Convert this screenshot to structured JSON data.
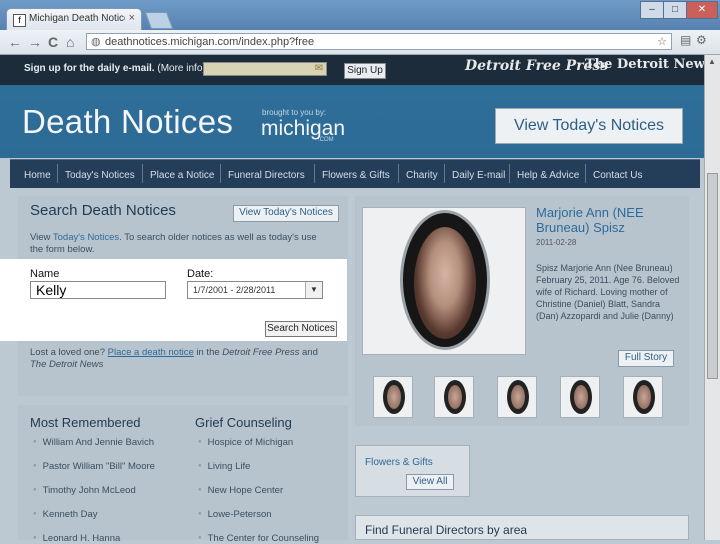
{
  "browser": {
    "tab_title": "Michigan Death Notices & S...",
    "tab_close": "×",
    "favicon": "f",
    "url": "deathnotices.michigan.com/index.php?free",
    "nav_back": "←",
    "nav_forward": "→",
    "reload": "C",
    "home": "⌂",
    "globe": "◍",
    "star": "☆",
    "wrench": "⚙",
    "win_min": "–",
    "win_max": "□",
    "win_close": "✕"
  },
  "signup": {
    "text_bold": "Sign up for the daily e-mail.",
    "text_more": "(More info)",
    "email_icon": "✉",
    "button": "Sign Up"
  },
  "papers": {
    "dfp": "Detroit Free Press",
    "tdn": "The Detroit News"
  },
  "header": {
    "logo": "Death Notices",
    "brought_by": "brought to you by:",
    "michigan": "michigan",
    "dotcom": ".COM",
    "view_button": "View Today's Notices"
  },
  "nav": [
    "Home",
    "Today's Notices",
    "Place a Notice",
    "Funeral Directors",
    "Flowers & Gifts",
    "Charity",
    "Daily E-mail",
    "Help & Advice",
    "Contact Us"
  ],
  "search": {
    "title": "Search Death Notices",
    "view_button": "View Today's Notices",
    "intro_pre": "View",
    "intro_link": "Today's Notices",
    "intro_post": ". To search older notices as well as today's use the form below.",
    "name_label": "Name",
    "name_value": "Kelly",
    "date_label": "Date:",
    "date_value": "1/7/2001 - 2/28/2011",
    "dropdown_icon": "▼",
    "button": "Search Notices"
  },
  "lost": {
    "pre": "Lost a loved one?",
    "link": "Place a death notice",
    "mid": "in the",
    "paper1": "Detroit Free Press",
    "and": "and",
    "paper2": "The Detroit News"
  },
  "obituary": {
    "name": "Marjorie Ann (NEE Bruneau) Spisz",
    "date": "2011-02-28",
    "text": "Spisz Marjorie Ann (Nee Bruneau) February 25, 2011. Age 76. Beloved wife of Richard. Loving mother of Christine (Daniel) Blatt, Sandra (Dan) Azzopardi and Julie (Danny)",
    "button": "Full Story"
  },
  "most_remembered": {
    "title": "Most Remembered",
    "items": [
      "William And Jennie Bavich",
      "Pastor William \"Bill\" Moore",
      "Timothy John McLeod",
      "Kenneth Day",
      "Leonard H. Hanna"
    ]
  },
  "grief": {
    "title": "Grief Counseling",
    "items": [
      "Hospice of Michigan",
      "Living Life",
      "New Hope Center",
      "Lowe-Peterson",
      "The Center for Counseling"
    ]
  },
  "flowers": {
    "title": "Flowers & Gifts",
    "button": "View All"
  },
  "funeral": {
    "title": "Find Funeral Directors by area"
  }
}
